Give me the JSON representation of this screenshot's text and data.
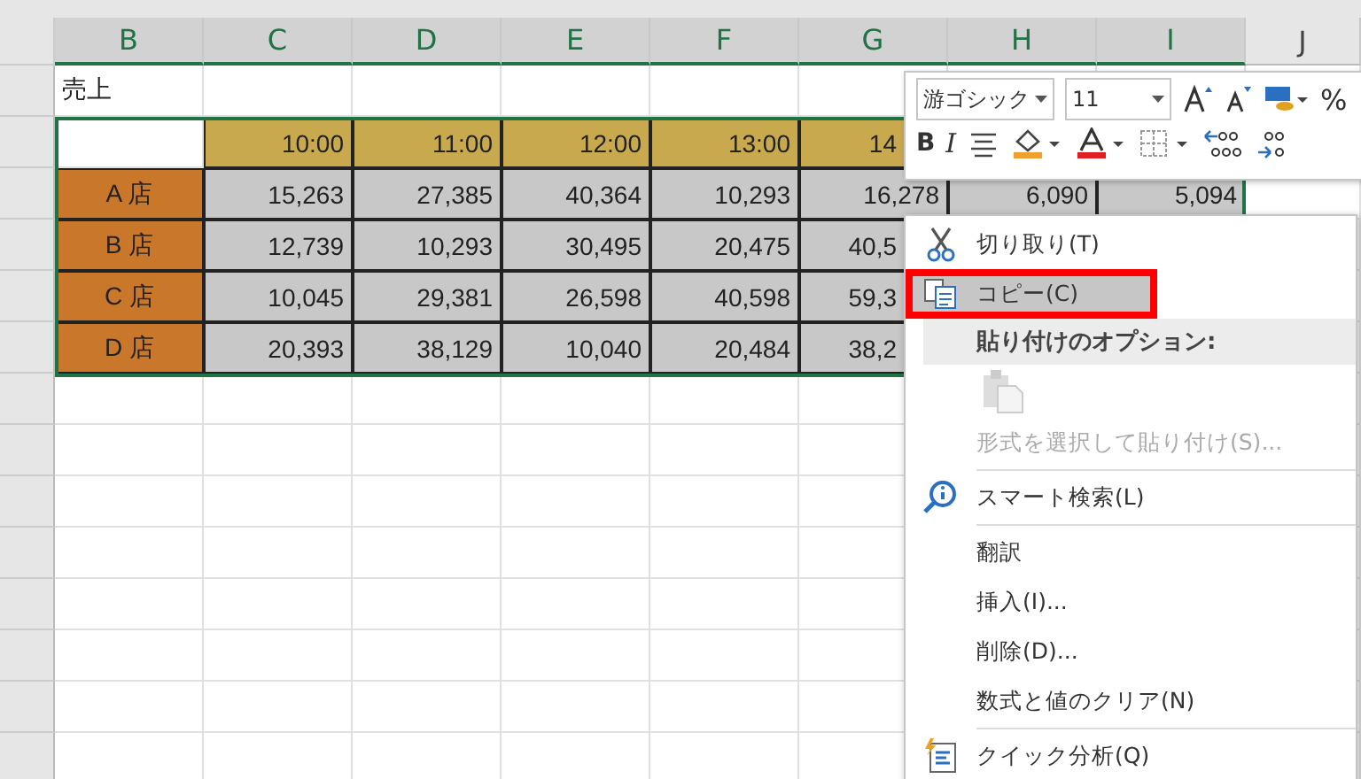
{
  "columns": [
    {
      "label": "B",
      "selected": true
    },
    {
      "label": "C",
      "selected": true
    },
    {
      "label": "D",
      "selected": true
    },
    {
      "label": "E",
      "selected": true
    },
    {
      "label": "F",
      "selected": true
    },
    {
      "label": "G",
      "selected": true
    },
    {
      "label": "H",
      "selected": true
    },
    {
      "label": "I",
      "selected": true
    },
    {
      "label": "J",
      "selected": false
    }
  ],
  "title_cell": "売上",
  "times": [
    "10:00",
    "11:00",
    "12:00",
    "13:00",
    "14"
  ],
  "stores": [
    {
      "label": "A 店",
      "values": [
        "15,263",
        "27,385",
        "40,364",
        "10,293",
        "16,278",
        "6,090",
        "5,094"
      ]
    },
    {
      "label": "B 店",
      "values": [
        "12,739",
        "10,293",
        "30,495",
        "20,475",
        "40,5"
      ]
    },
    {
      "label": "C 店",
      "values": [
        "10,045",
        "29,381",
        "26,598",
        "40,598",
        "59,3"
      ]
    },
    {
      "label": "D 店",
      "values": [
        "20,393",
        "38,129",
        "10,040",
        "20,484",
        "38,2"
      ]
    }
  ],
  "mini_toolbar": {
    "font": "游ゴシック",
    "size": "11",
    "bold": "B",
    "italic": "I",
    "percent": "%"
  },
  "context_menu": [
    {
      "kind": "cut",
      "label": "切り取り(T)",
      "selected": false,
      "highlighted": false
    },
    {
      "kind": "copy",
      "label": "コピー(C)",
      "selected": true,
      "highlighted": true
    },
    {
      "kind": "header",
      "label": "貼り付けのオプション:"
    },
    {
      "kind": "paste"
    },
    {
      "kind": "plain",
      "label": "形式を選択して貼り付け(S)...",
      "disabled": true,
      "selected": false,
      "highlighted": false
    },
    {
      "kind": "separator"
    },
    {
      "kind": "search",
      "label": "スマート検索(L)",
      "selected": false,
      "highlighted": false
    },
    {
      "kind": "separator"
    },
    {
      "kind": "plain",
      "label": "翻訳",
      "selected": false,
      "highlighted": false
    },
    {
      "kind": "plain",
      "label": "挿入(I)...",
      "selected": false,
      "highlighted": false
    },
    {
      "kind": "plain",
      "label": "削除(D)...",
      "selected": false,
      "highlighted": false
    },
    {
      "kind": "plain",
      "label": "数式と値のクリア(N)",
      "selected": false,
      "highlighted": false
    },
    {
      "kind": "separator"
    },
    {
      "kind": "analysis",
      "label": "クイック分析(Q)",
      "selected": false,
      "highlighted": false
    }
  ]
}
